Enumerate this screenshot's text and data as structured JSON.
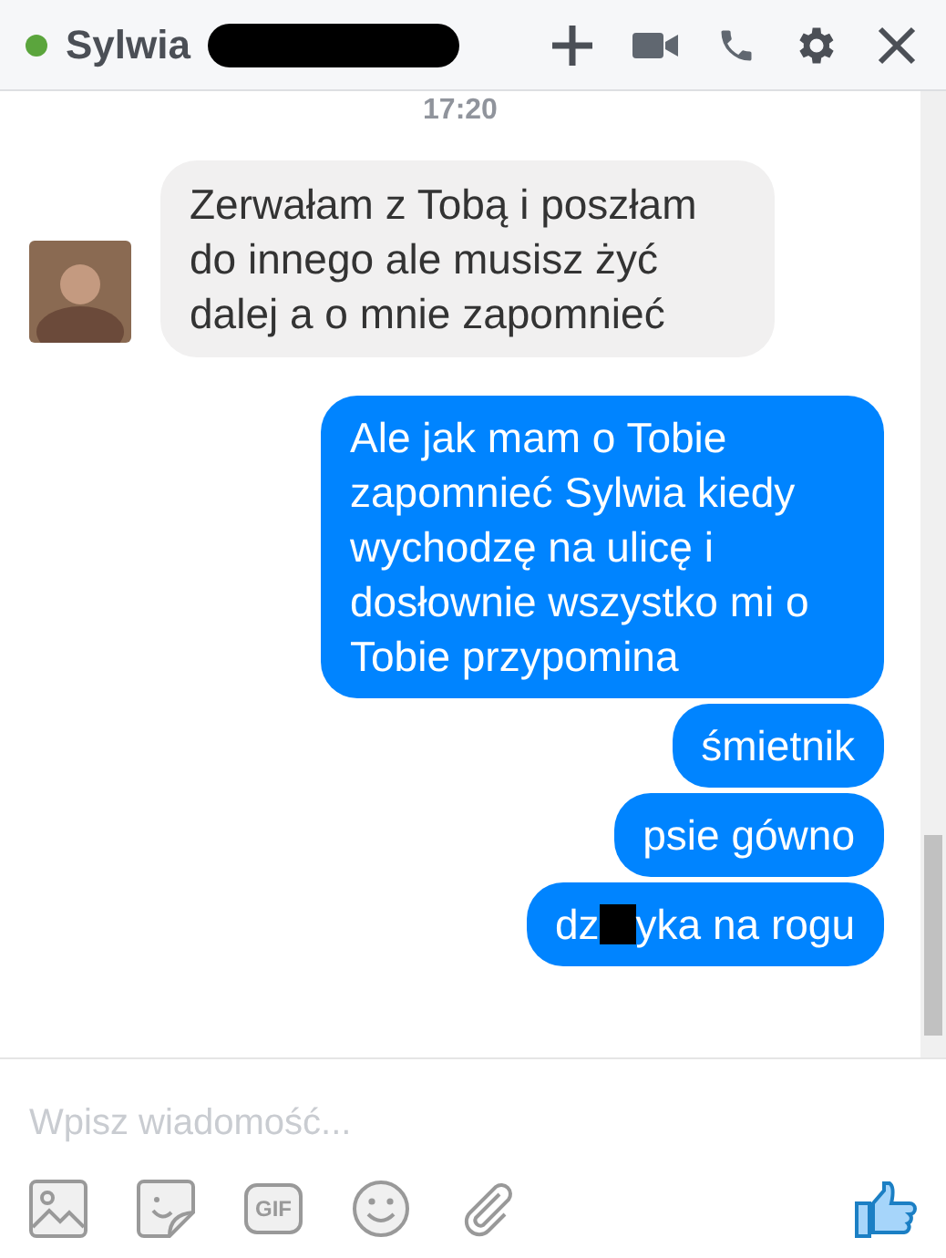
{
  "header": {
    "online": true,
    "name": "Sylwia",
    "name_redacted": true
  },
  "time": "17:20",
  "messages": [
    {
      "kind": "received",
      "text": "Zerwałam z Tobą i poszłam do innego ale musisz żyć dalej a o mnie zapomnieć"
    },
    {
      "kind": "sent",
      "text": "Ale jak mam o Tobie zapomnieć Sylwia kiedy wychodzę na ulicę i dosłownie wszystko mi o Tobie przypomina"
    },
    {
      "kind": "sent",
      "text": "śmietnik"
    },
    {
      "kind": "sent",
      "text": "psie gówno"
    },
    {
      "kind": "sent",
      "segments": [
        {
          "kind": "text",
          "text": "dz"
        },
        {
          "kind": "redaction"
        },
        {
          "kind": "text",
          "text": "yka na rogu"
        }
      ]
    }
  ],
  "composer": {
    "placeholder": "Wpisz wiadomość..."
  },
  "toolbar": [
    {
      "kind": "photo"
    },
    {
      "kind": "sticker"
    },
    {
      "kind": "gif",
      "label": "GIF"
    },
    {
      "kind": "emoji"
    },
    {
      "kind": "attach"
    }
  ]
}
